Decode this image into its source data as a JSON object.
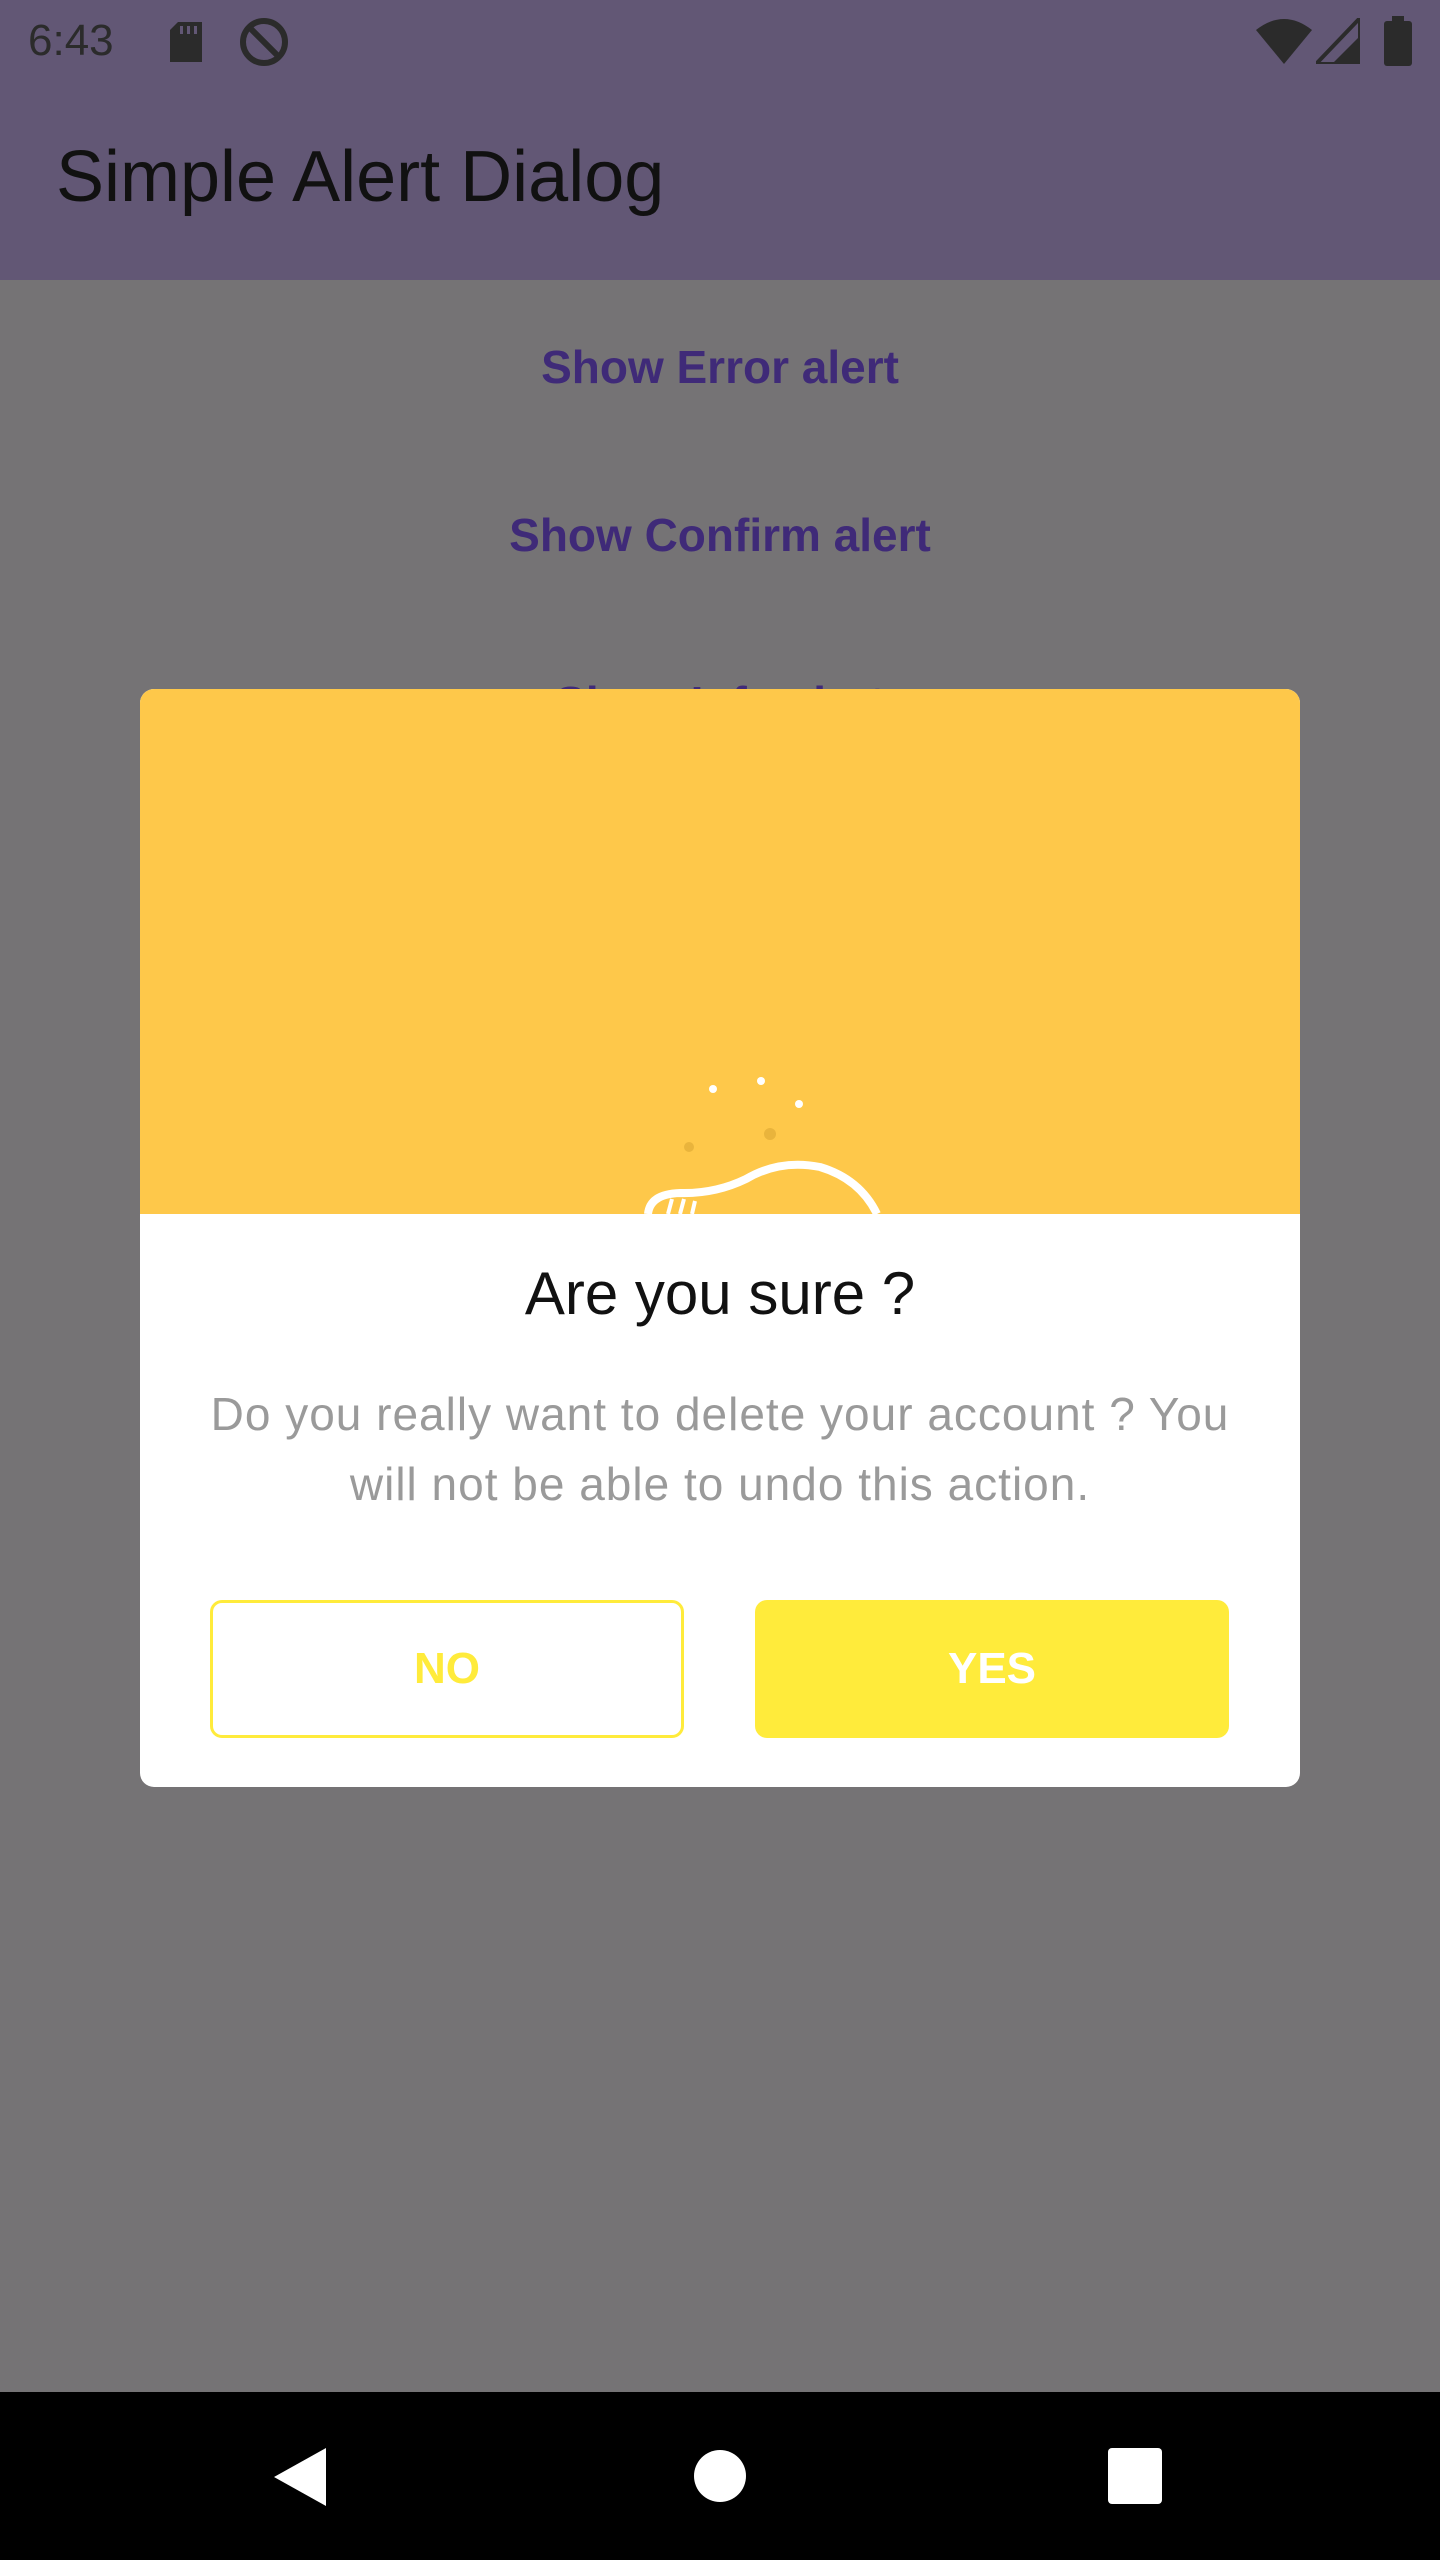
{
  "status_bar": {
    "time": "6:43",
    "left_icons": [
      "sd-card-icon",
      "do-not-disturb-icon"
    ],
    "right_icons": [
      "wifi-icon",
      "cell-signal-icon",
      "battery-icon"
    ]
  },
  "app_bar": {
    "title": "Simple Alert Dialog"
  },
  "menu": {
    "items": [
      "Show Error alert",
      "Show Confirm alert",
      "Show Info alert"
    ]
  },
  "dialog": {
    "title": "Are you sure ?",
    "message": "Do you really want to delete your account ? You will not be able to undo this action.",
    "no_label": "NO",
    "yes_label": "YES",
    "hero_icon": "confirm-illustration-icon",
    "colors": {
      "hero": "#fec84a",
      "accent": "#ffeb3b",
      "message": "#9a9a9a"
    }
  },
  "nav_bar": {
    "icons": [
      "back-icon",
      "home-icon",
      "recents-icon"
    ]
  },
  "colors": {
    "app_bar": "#625775",
    "scrim": "#757375",
    "link": "#3f2a78"
  }
}
